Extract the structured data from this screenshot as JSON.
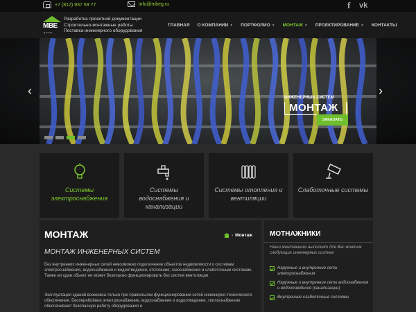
{
  "topbar": {
    "phone": "+7 (812) 937 59 77",
    "email": "info@mbeg.ru",
    "social": [
      {
        "name": "facebook-icon",
        "glyph": "f"
      },
      {
        "name": "vk-icon",
        "glyph": "vk"
      }
    ]
  },
  "header": {
    "logo_text": "MBE",
    "logo_sub": "group",
    "tagline": [
      "Разработка проектной документации",
      "Строительно-монтажные работы",
      "Поставка инженерного оборудования"
    ],
    "nav": [
      {
        "label": "ГЛАВНАЯ",
        "caret": false,
        "active": false
      },
      {
        "label": "О КОМПАНИИ",
        "caret": true,
        "active": false
      },
      {
        "label": "ПОРТФОЛИО",
        "caret": true,
        "active": false
      },
      {
        "label": "МОНТАЖ",
        "caret": true,
        "active": true
      },
      {
        "label": "ПРОЕКТИРОВАНИЕ",
        "caret": true,
        "active": false
      },
      {
        "label": "КОНТАКТЫ",
        "caret": false,
        "active": false
      }
    ]
  },
  "slider": {
    "caption_small": "ИНЖЕНЕРНЫХ СИСТЕМ",
    "caption_big": "МОНТАЖ",
    "button": "ЗАКАЗАТЬ",
    "prev": "‹",
    "next": "›",
    "slides": 4,
    "active_slide": 3
  },
  "services": [
    {
      "label": "Системы электроснабжения",
      "icon": "lightbulb-icon",
      "active": true
    },
    {
      "label": "Системы водоснабжения и канализации",
      "icon": "faucet-icon",
      "active": false
    },
    {
      "label": "Системы отопления и вентиляции",
      "icon": "radiator-icon",
      "active": false
    },
    {
      "label": "Слаботочные системы",
      "icon": "cctv-camera-icon",
      "active": false
    }
  ],
  "main": {
    "title": "МОНТАЖ",
    "breadcrumb_current": "Монтаж",
    "subtitle": "МОНТАЖ ИНЖЕНЕРНЫХ СИСТЕМ",
    "p1": "Без внутренних инженерных сетей невозможно подключение объектов недвижимости к системам электроснабжения, водоснабжения и водоотведения, отопления, газоснабжения и слаботочным системам. Также ни один объект не может безопасно функционировать без систем вентиляции.",
    "p2": "Эксплуатация зданий возможна только при правильном функционировании сетей инженерно-технического обеспечения. Бесперебойное электроснабжение, водоснабжение и водоотведение, теплоснабжение обеспечивают безопасную работу оборудования и"
  },
  "aside": {
    "title": "МОТНАЖНИКИ",
    "intro": "Наши монтажники выполнят для Вас монтаж следующих инженерных систем:",
    "items": [
      "Наружные и внутренние сети электроснабжения",
      "Наружные и внутренние сети водоснабжения и водоотведения (канализации)",
      "Внутренние слаботочные системы"
    ]
  },
  "colors": {
    "accent": "#6fbf2c",
    "background": "#141414",
    "card": "#1a1a1a"
  }
}
